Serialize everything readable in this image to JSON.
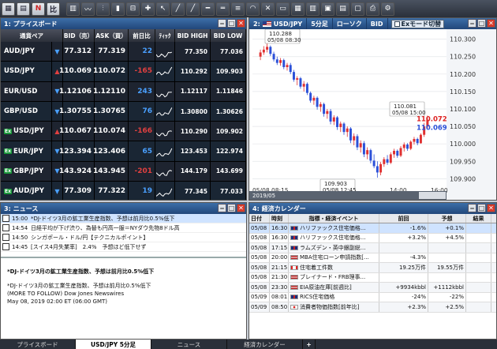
{
  "colors": {
    "up": "#e04040",
    "down": "#4aa0ff",
    "candle_up": "#e03030",
    "candle_down": "#2b50d8",
    "title_bar": "#22477a"
  },
  "price_board": {
    "title": "プライスボード",
    "headers": [
      "通貨ペア",
      "BID（売）",
      "ASK（買）",
      "前日比",
      "ﾃｨｯｸ",
      "BID HIGH",
      "BID LOW"
    ],
    "rows": [
      {
        "ex": "",
        "pair": "AUD/JPY",
        "dir": "down",
        "bid": "77.312",
        "ask": "77.319",
        "chg": "22",
        "hi": "77.350",
        "lo": "77.036"
      },
      {
        "ex": "",
        "pair": "USD/JPY",
        "dir": "up",
        "bid": "110.069",
        "ask": "110.072",
        "chg": "-165",
        "hi": "110.292",
        "lo": "109.903"
      },
      {
        "ex": "",
        "pair": "EUR/USD",
        "dir": "down",
        "bid": "1.12106",
        "ask": "1.12110",
        "chg": "243",
        "hi": "1.12117",
        "lo": "1.11846"
      },
      {
        "ex": "",
        "pair": "GBP/USD",
        "dir": "down",
        "bid": "1.30755",
        "ask": "1.30765",
        "chg": "76",
        "hi": "1.30800",
        "lo": "1.30626"
      },
      {
        "ex": "Ex",
        "pair": "USD/JPY",
        "dir": "up",
        "bid": "110.067",
        "ask": "110.074",
        "chg": "-166",
        "hi": "110.290",
        "lo": "109.902"
      },
      {
        "ex": "Ex",
        "pair": "EUR/JPY",
        "dir": "down",
        "bid": "123.394",
        "ask": "123.406",
        "chg": "65",
        "hi": "123.453",
        "lo": "122.974"
      },
      {
        "ex": "Ex",
        "pair": "GBP/JPY",
        "dir": "down",
        "bid": "143.924",
        "ask": "143.945",
        "chg": "-201",
        "hi": "144.179",
        "lo": "143.699"
      },
      {
        "ex": "Ex",
        "pair": "AUD/JPY",
        "dir": "down",
        "bid": "77.309",
        "ask": "77.322",
        "chg": "19",
        "hi": "77.345",
        "lo": "77.033"
      }
    ]
  },
  "chart": {
    "symbol": "USD/JPY",
    "timeframe": "5分足",
    "style": "ローソク",
    "side": "BID",
    "ex_toggle": "Exモード切替",
    "year_label": "2019/05",
    "high_label": {
      "price": "110.288",
      "time": "05/08 08:30"
    },
    "last_label": {
      "price": "110.081",
      "time": "05/08 15:00"
    },
    "low_label": {
      "price": "109.903",
      "time": "05/08 12:45"
    },
    "ask_badge": "110.072",
    "bid_badge": "110.069"
  },
  "chart_data": {
    "type": "candlestick",
    "x_ticks": [
      "05/08 08:15",
      "12:00",
      "14:00",
      "16:00"
    ],
    "y_ticks": [
      "110.300",
      "110.250",
      "110.200",
      "110.150",
      "110.100",
      "110.050",
      "110.000",
      "109.950",
      "109.900"
    ],
    "ylim": [
      109.885,
      110.315
    ],
    "candles": [
      [
        110.25,
        110.27,
        110.24,
        110.262
      ],
      [
        110.262,
        110.28,
        110.255,
        110.27
      ],
      [
        110.27,
        110.288,
        110.262,
        110.278
      ],
      [
        110.278,
        110.282,
        110.252,
        110.258
      ],
      [
        110.258,
        110.264,
        110.236,
        110.242
      ],
      [
        110.242,
        110.25,
        110.226,
        110.232
      ],
      [
        110.232,
        110.246,
        110.224,
        110.24
      ],
      [
        110.24,
        110.244,
        110.214,
        110.22
      ],
      [
        110.22,
        110.232,
        110.21,
        110.226
      ],
      [
        110.226,
        110.232,
        110.2,
        110.206
      ],
      [
        110.206,
        110.212,
        110.178,
        110.184
      ],
      [
        110.184,
        110.194,
        110.168,
        110.188
      ],
      [
        110.188,
        110.192,
        110.158,
        110.164
      ],
      [
        110.164,
        110.18,
        110.15,
        110.172
      ],
      [
        110.172,
        110.176,
        110.14,
        110.146
      ],
      [
        110.146,
        110.15,
        110.118,
        110.124
      ],
      [
        110.124,
        110.138,
        110.112,
        110.132
      ],
      [
        110.132,
        110.136,
        110.098,
        110.106
      ],
      [
        110.106,
        110.12,
        110.092,
        110.114
      ],
      [
        110.114,
        110.118,
        110.078,
        110.086
      ],
      [
        110.086,
        110.1,
        110.072,
        110.094
      ],
      [
        110.094,
        110.1,
        110.056,
        110.064
      ],
      [
        110.064,
        110.082,
        110.054,
        110.076
      ],
      [
        110.076,
        110.08,
        110.04,
        110.048
      ],
      [
        110.048,
        110.064,
        110.034,
        110.058
      ],
      [
        110.058,
        110.062,
        110.026,
        110.034
      ],
      [
        110.034,
        110.05,
        110.02,
        110.044
      ],
      [
        110.044,
        110.048,
        110.002,
        110.01
      ],
      [
        110.01,
        110.03,
        109.996,
        110.022
      ],
      [
        110.022,
        110.028,
        109.982,
        109.99
      ],
      [
        109.99,
        110.01,
        109.975,
        110.002
      ],
      [
        110.002,
        110.008,
        109.962,
        109.97
      ],
      [
        109.97,
        109.99,
        109.956,
        109.982
      ],
      [
        109.982,
        109.986,
        109.944,
        109.952
      ],
      [
        109.952,
        109.97,
        109.93,
        109.936
      ],
      [
        109.936,
        109.95,
        109.903,
        109.918
      ],
      [
        109.918,
        109.948,
        109.91,
        109.942
      ],
      [
        109.942,
        109.962,
        109.934,
        109.956
      ],
      [
        109.956,
        109.968,
        109.94,
        109.946
      ],
      [
        109.946,
        109.976,
        109.942,
        109.97
      ],
      [
        109.97,
        109.986,
        109.96,
        109.98
      ],
      [
        109.98,
        109.984,
        109.96,
        109.966
      ],
      [
        109.966,
        109.994,
        109.962,
        109.988
      ],
      [
        109.988,
        110.004,
        109.978,
        109.998
      ],
      [
        109.998,
        110.002,
        109.98,
        109.986
      ],
      [
        109.986,
        110.01,
        109.982,
        110.006
      ],
      [
        110.006,
        110.02,
        109.998,
        110.014
      ],
      [
        110.014,
        110.018,
        109.996,
        110.002
      ],
      [
        110.002,
        110.03,
        110.0,
        110.026
      ],
      [
        110.026,
        110.06,
        110.02,
        110.05
      ],
      [
        110.05,
        110.081,
        110.044,
        110.069
      ]
    ]
  },
  "news": {
    "title": "ニュース",
    "items": [
      {
        "time": "15:00",
        "text": "*DJ-ドイツ3月の鉱工業生産指数、予想は前月比0.5%低下",
        "selected": true
      },
      {
        "time": "14:54",
        "text": "日経平均が下げ渋り、為替も円高一服＝NYダウ先物8ドル高",
        "selected": false
      },
      {
        "time": "14:50",
        "text": "シンガポール・ドル/円【テクニカルポイント】",
        "selected": false
      },
      {
        "time": "14:45",
        "text": "[スイス4月失業率]　2.4%　予想ほど低下せず",
        "selected": false
      }
    ],
    "detail": {
      "headline": "*DJ-ドイツ3月の鉱工業生産指数、予想は前月比0.5%低下",
      "line1": "*DJ-ドイツ3月の鉱工業生産指数、予想は前月比0.5%低下",
      "line2": "(MORE TO FOLLOW) Dow Jones Newswires",
      "line3": "May 08, 2019 02:00 ET (06:00 GMT)"
    }
  },
  "calendar": {
    "title": "経済カレンダー",
    "headers": [
      "日付",
      "時刻",
      "指標・経済イベント",
      "前回",
      "予想",
      "結果"
    ],
    "rows": [
      {
        "date": "05/08",
        "time": "16:30",
        "flag": "uk",
        "event": "ハリファックス住宅価格...",
        "prev": "-1.6%",
        "fc": "+0.1%",
        "res": "",
        "sel": true
      },
      {
        "date": "05/08",
        "time": "16:30",
        "flag": "uk",
        "event": "ハリファックス住宅価格...",
        "prev": "+3.2%",
        "fc": "+4.5%",
        "res": "",
        "sel": false
      },
      {
        "date": "05/08",
        "time": "17:15",
        "flag": "uk",
        "event": "ラムズデン・英中銀副総...",
        "prev": "",
        "fc": "",
        "res": "",
        "sel": false
      },
      {
        "date": "05/08",
        "time": "20:00",
        "flag": "us",
        "event": "MBA住宅ローン申請指数[...",
        "prev": "-4.3%",
        "fc": "",
        "res": "",
        "sel": false
      },
      {
        "date": "05/08",
        "time": "21:15",
        "flag": "ca",
        "event": "住宅着工件数",
        "prev": "19.25万件",
        "fc": "19.55万件",
        "res": "",
        "sel": false
      },
      {
        "date": "05/08",
        "time": "21:30",
        "flag": "us",
        "event": "ブレイナード・FRB理事...",
        "prev": "",
        "fc": "",
        "res": "",
        "sel": false
      },
      {
        "date": "05/08",
        "time": "23:30",
        "flag": "us",
        "event": "EIA原油在庫[前週比]",
        "prev": "+9934kbbl",
        "fc": "+1112kbbl",
        "res": "",
        "sel": false
      },
      {
        "date": "05/09",
        "time": "08:01",
        "flag": "uk",
        "event": "RICS住宅価格",
        "prev": "-24%",
        "fc": "-22%",
        "res": "",
        "sel": false
      },
      {
        "date": "05/09",
        "time": "08:50",
        "flag": "jp",
        "event": "消費者物価指数[前年比]",
        "prev": "+2.3%",
        "fc": "+2.5%",
        "res": "",
        "sel": false
      }
    ]
  },
  "tabs": [
    "プライスボード",
    "USD/JPY 5分足",
    "ニュース",
    "経済カレンダー",
    "+"
  ]
}
